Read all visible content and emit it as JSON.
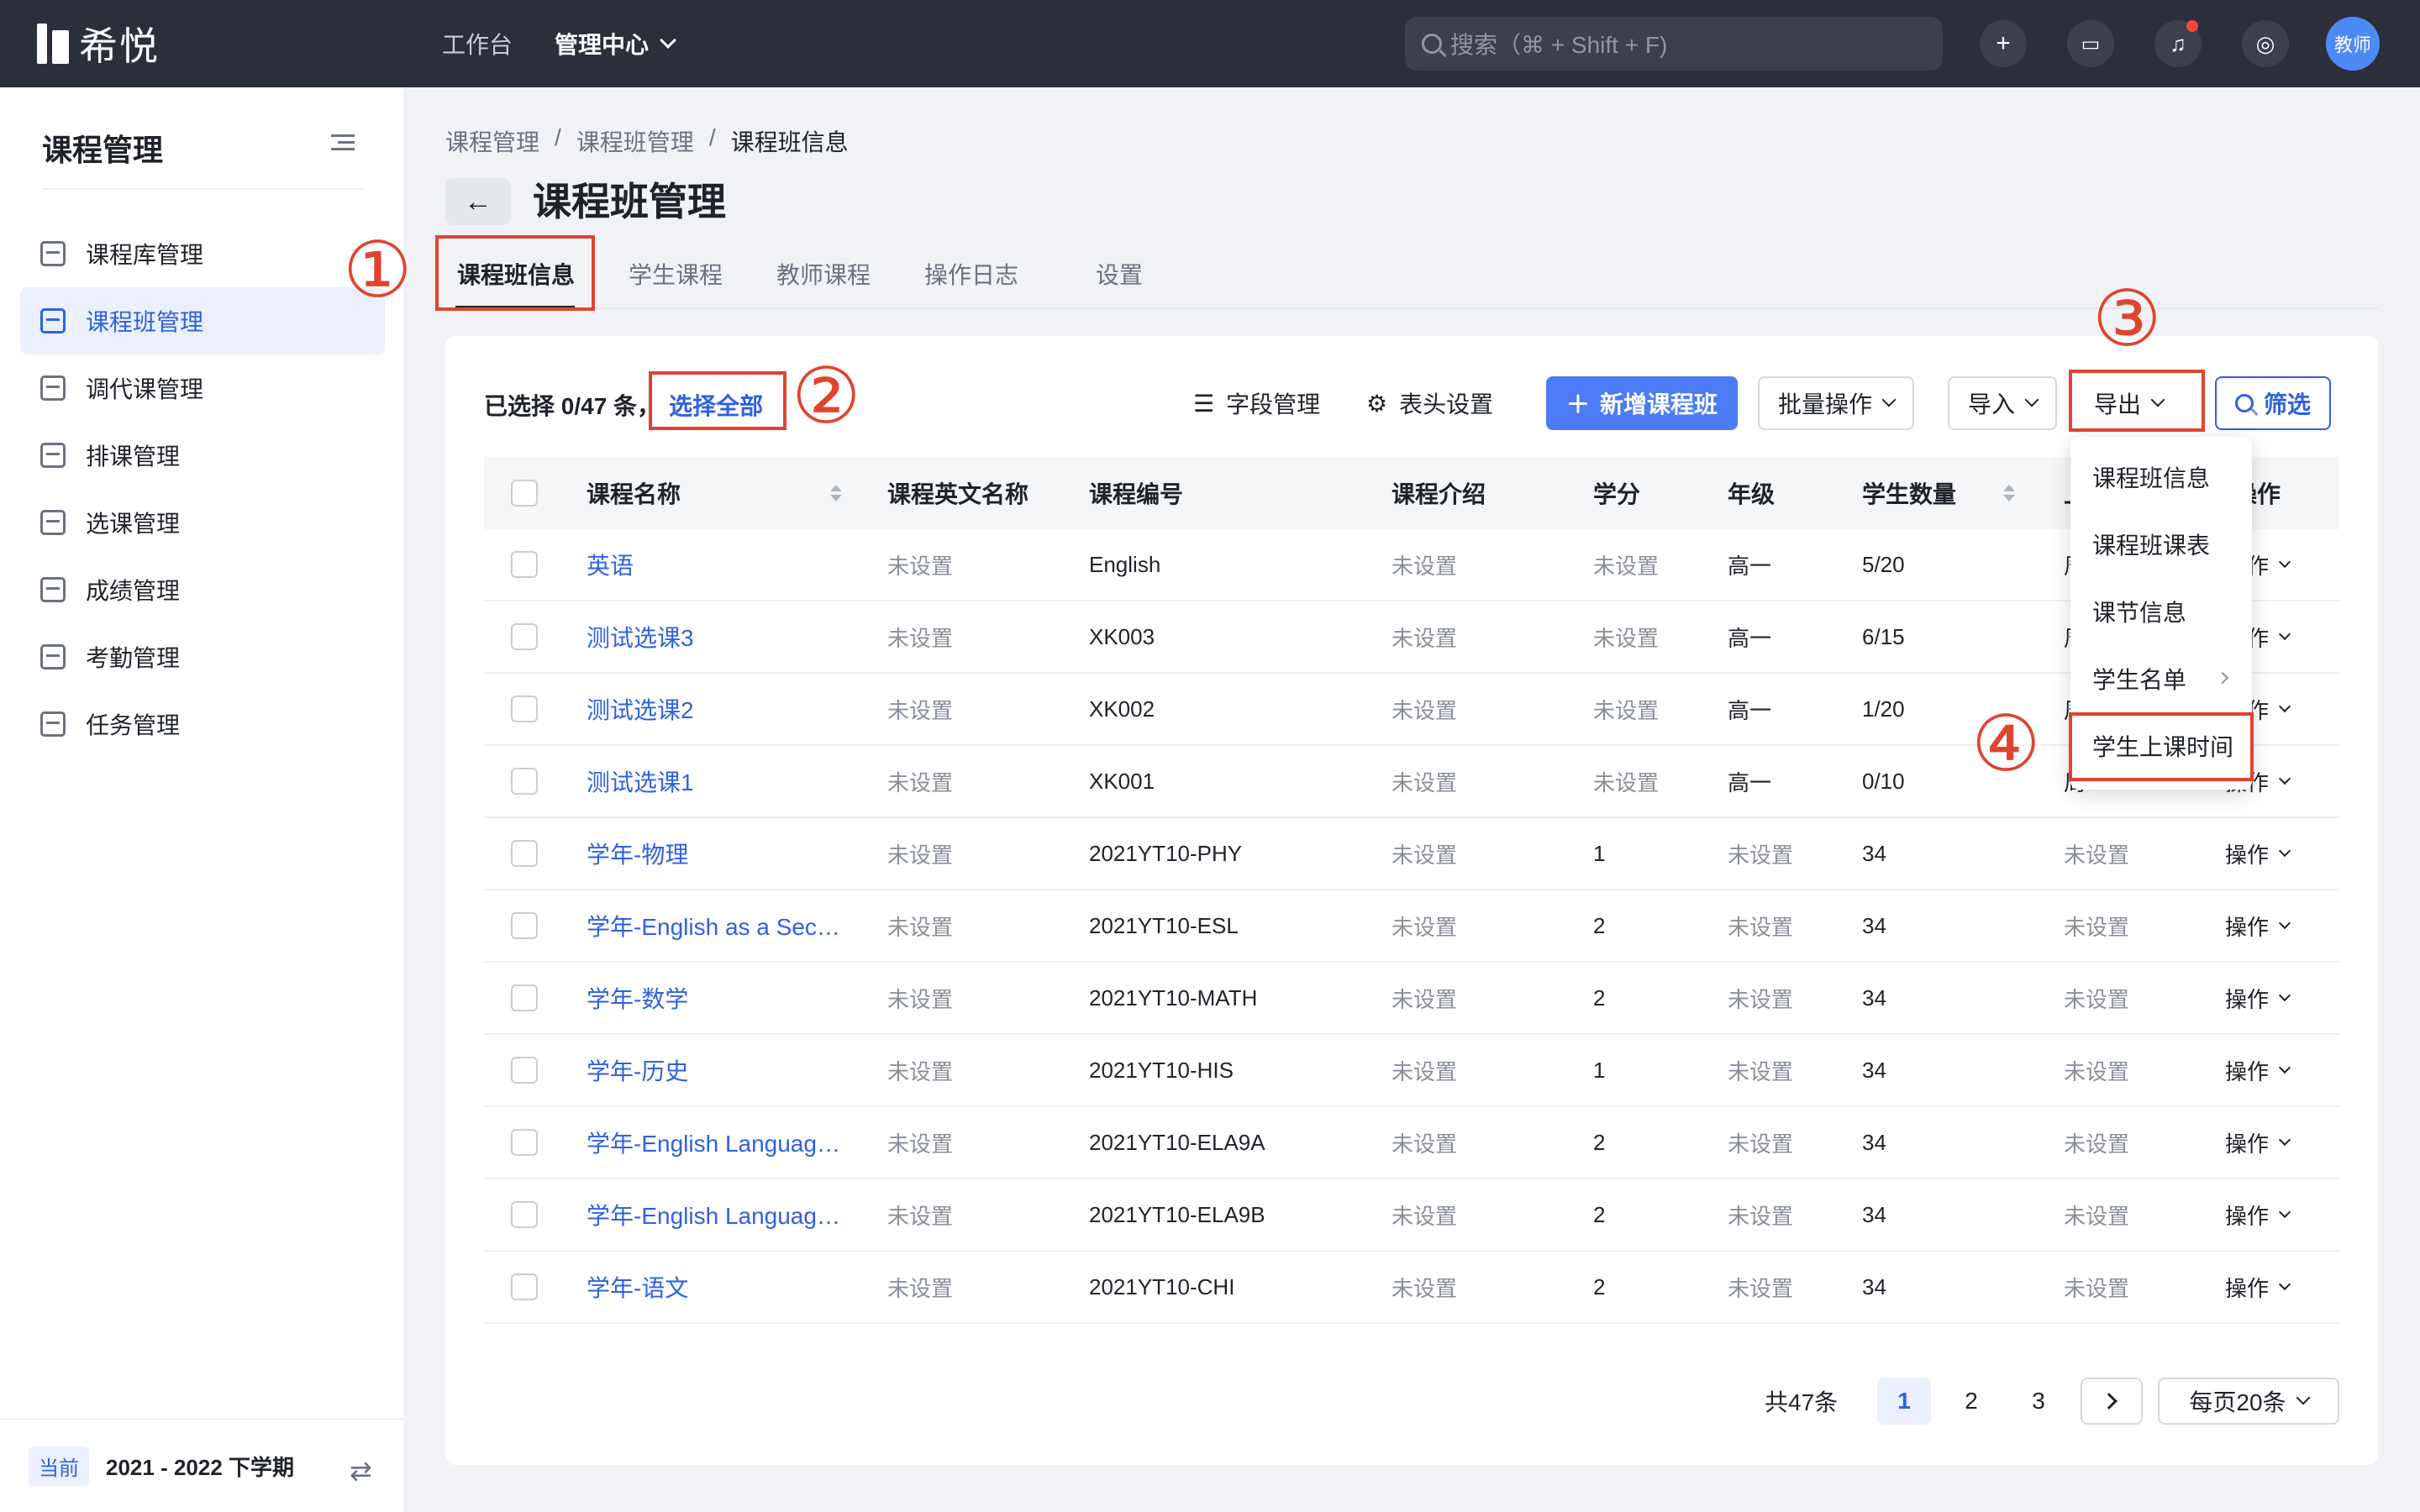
{
  "brand": {
    "name": "希悦"
  },
  "topnav": {
    "workbench": "工作台",
    "admin_center": "管理中心"
  },
  "search": {
    "placeholder": "搜索（⌘ + Shift + F)"
  },
  "user": {
    "avatar_text": "教师"
  },
  "colors": {
    "accent": "#2f61e0",
    "primary_button": "#4b7bf5",
    "annotation": "#e0442f",
    "topbar": "#2b2f3a"
  },
  "sidebar": {
    "title": "课程管理",
    "items": [
      {
        "label": "课程库管理",
        "icon": "database-icon",
        "active": false
      },
      {
        "label": "课程班管理",
        "icon": "class-icon",
        "active": true
      },
      {
        "label": "调代课管理",
        "icon": "swap-doc-icon",
        "active": false
      },
      {
        "label": "排课管理",
        "icon": "schedule-icon",
        "active": false
      },
      {
        "label": "选课管理",
        "icon": "checklist-icon",
        "active": false
      },
      {
        "label": "成绩管理",
        "icon": "grade-icon",
        "active": false
      },
      {
        "label": "考勤管理",
        "icon": "calendar-icon",
        "active": false
      },
      {
        "label": "任务管理",
        "icon": "task-list-icon",
        "active": false
      }
    ],
    "footer": {
      "badge": "当前",
      "term": "2021 - 2022 下学期"
    }
  },
  "breadcrumb": [
    "课程管理",
    "/",
    "课程班管理",
    "/",
    "课程班信息"
  ],
  "page": {
    "title": "课程班管理"
  },
  "tabs": [
    "课程班信息",
    "学生课程",
    "教师课程",
    "操作日志",
    "设置"
  ],
  "selection": {
    "text": "已选择 0/47 条，",
    "select_all": "选择全部"
  },
  "toolbar": {
    "field_mgmt": "字段管理",
    "header_settings": "表头设置",
    "new_class": "新增课程班",
    "batch": "批量操作",
    "import": "导入",
    "export": "导出",
    "filter": "筛选"
  },
  "annotations": [
    "①",
    "②",
    "③",
    "④"
  ],
  "table": {
    "columns": [
      "课程名称",
      "课程英文名称",
      "课程编号",
      "课程介绍",
      "学分",
      "年级",
      "学生数量",
      "上",
      "操作"
    ],
    "rows": [
      {
        "name": "英语",
        "en": "未设置",
        "code": "English",
        "intro": "未设置",
        "credit": "未设置",
        "grade": "高一",
        "count": "5/20",
        "extra": "周",
        "op": "操作"
      },
      {
        "name": "测试选课3",
        "en": "未设置",
        "code": "XK003",
        "intro": "未设置",
        "credit": "未设置",
        "grade": "高一",
        "count": "6/15",
        "extra": "周",
        "op": "操作"
      },
      {
        "name": "测试选课2",
        "en": "未设置",
        "code": "XK002",
        "intro": "未设置",
        "credit": "未设置",
        "grade": "高一",
        "count": "1/20",
        "extra": "周",
        "op": "操作"
      },
      {
        "name": "测试选课1",
        "en": "未设置",
        "code": "XK001",
        "intro": "未设置",
        "credit": "未设置",
        "grade": "高一",
        "count": "0/10",
        "extra": "周",
        "op": "操作"
      },
      {
        "name": "学年-物理",
        "en": "未设置",
        "code": "2021YT10-PHY",
        "intro": "未设置",
        "credit": "1",
        "grade": "未设置",
        "count": "34",
        "extra": "未设置",
        "op": "操作"
      },
      {
        "name": "学年-English as a Sec…",
        "en": "未设置",
        "code": "2021YT10-ESL",
        "intro": "未设置",
        "credit": "2",
        "grade": "未设置",
        "count": "34",
        "extra": "未设置",
        "op": "操作"
      },
      {
        "name": "学年-数学",
        "en": "未设置",
        "code": "2021YT10-MATH",
        "intro": "未设置",
        "credit": "2",
        "grade": "未设置",
        "count": "34",
        "extra": "未设置",
        "op": "操作"
      },
      {
        "name": "学年-历史",
        "en": "未设置",
        "code": "2021YT10-HIS",
        "intro": "未设置",
        "credit": "1",
        "grade": "未设置",
        "count": "34",
        "extra": "未设置",
        "op": "操作"
      },
      {
        "name": "学年-English Languag…",
        "en": "未设置",
        "code": "2021YT10-ELA9A",
        "intro": "未设置",
        "credit": "2",
        "grade": "未设置",
        "count": "34",
        "extra": "未设置",
        "op": "操作"
      },
      {
        "name": "学年-English Languag…",
        "en": "未设置",
        "code": "2021YT10-ELA9B",
        "intro": "未设置",
        "credit": "2",
        "grade": "未设置",
        "count": "34",
        "extra": "未设置",
        "op": "操作"
      },
      {
        "name": "学年-语文",
        "en": "未设置",
        "code": "2021YT10-CHI",
        "intro": "未设置",
        "credit": "2",
        "grade": "未设置",
        "count": "34",
        "extra": "未设置",
        "op": "操作"
      }
    ]
  },
  "export_menu": [
    "课程班信息",
    "课程班课表",
    "课节信息",
    "学生名单",
    "学生上课时间"
  ],
  "pagination": {
    "total": "共47条",
    "pages": [
      "1",
      "2",
      "3"
    ],
    "current": "1",
    "page_size": "每页20条"
  }
}
